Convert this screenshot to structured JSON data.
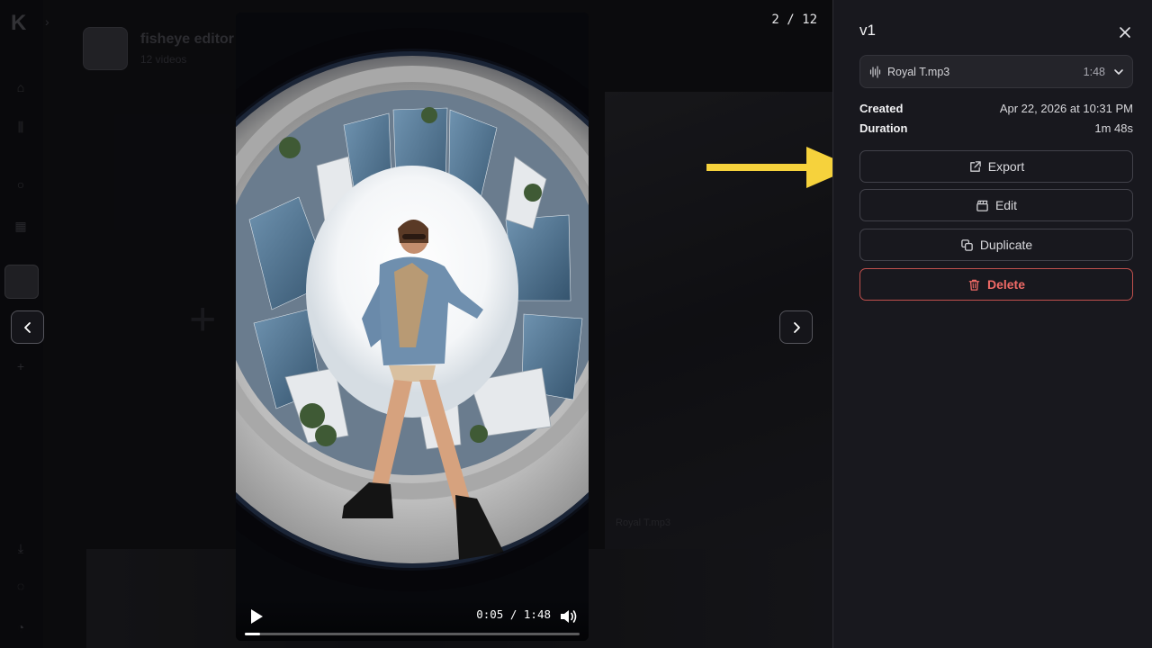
{
  "background": {
    "logo": "K",
    "project_title": "fisheye editor",
    "project_subtitle": "12 videos",
    "card_caption": "Royal T.mp3"
  },
  "lightbox": {
    "counter": "2 / 12",
    "video": {
      "current_time": "0:05",
      "total_time": "1:48",
      "time_separator": "/",
      "progress": 0.046
    }
  },
  "panel": {
    "title": "v1",
    "audio": {
      "filename": "Royal T.mp3",
      "duration": "1:48"
    },
    "meta": [
      {
        "key": "Created",
        "value": "Apr 22, 2026 at 10:31 PM"
      },
      {
        "key": "Duration",
        "value": "1m 48s"
      }
    ],
    "actions": {
      "export": "Export",
      "edit": "Edit",
      "duplicate": "Duplicate",
      "delete": "Delete"
    }
  },
  "colors": {
    "panel_bg": "#18181e",
    "delete": "#ef6a66",
    "annotation_arrow": "#f6d23c"
  },
  "icons": [
    "close-icon",
    "waveform-icon",
    "chevron-down-icon",
    "external-link-icon",
    "clapperboard-icon",
    "copy-icon",
    "trash-icon",
    "play-icon",
    "volume-icon",
    "chevron-left-icon",
    "chevron-right-icon"
  ]
}
